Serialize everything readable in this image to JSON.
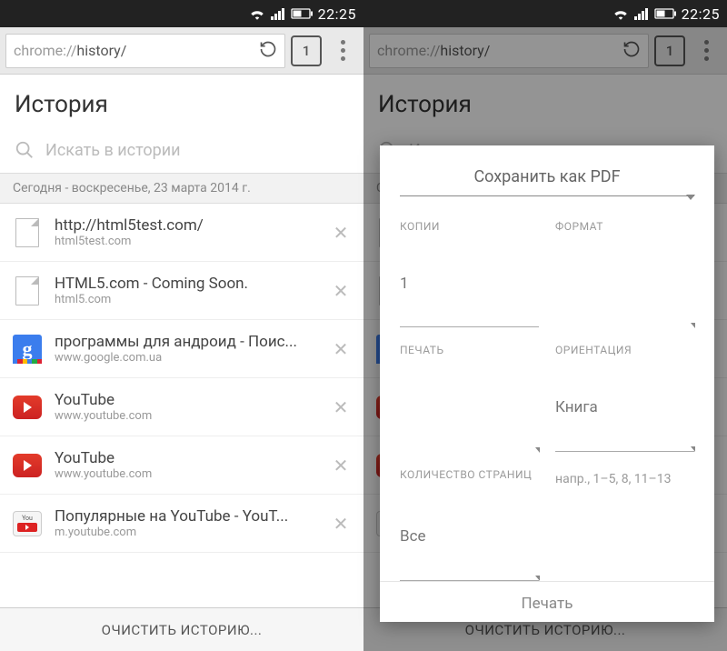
{
  "status": {
    "time": "22:25"
  },
  "toolbar": {
    "url_scheme": "chrome://",
    "url_path": "history/",
    "tab_count": "1"
  },
  "page": {
    "title": "История",
    "search_placeholder": "Искать в истории",
    "date_header": "Сегодня - воскресенье, 23 марта 2014 г.",
    "clear_label": "ОЧИСТИТЬ ИСТОРИЮ..."
  },
  "history": [
    {
      "icon": "doc",
      "title": "http://html5test.com/",
      "url": "html5test.com"
    },
    {
      "icon": "doc",
      "title": "HTML5.com - Coming Soon.",
      "url": "html5.com"
    },
    {
      "icon": "google",
      "title": "программы для андроид - Поис...",
      "url": "www.google.com.ua"
    },
    {
      "icon": "yt",
      "title": "YouTube",
      "url": "www.youtube.com"
    },
    {
      "icon": "yt",
      "title": "YouTube",
      "url": "www.youtube.com"
    },
    {
      "icon": "myt",
      "title": "Популярные на YouTube - YouT...",
      "url": "m.youtube.com"
    }
  ],
  "dialog": {
    "title": "Сохранить как PDF",
    "copies_label": "КОПИИ",
    "copies_value": "1",
    "format_label": "ФОРМАТ",
    "print_label": "ПЕЧАТЬ",
    "orientation_label": "ОРИЕНТАЦИЯ",
    "orientation_value": "Книга",
    "pages_label": "КОЛИЧЕСТВО СТРАНИЦ",
    "pages_value": "Все",
    "pages_hint": "напр., 1–5, 8, 11–13",
    "print_button": "Печать"
  }
}
